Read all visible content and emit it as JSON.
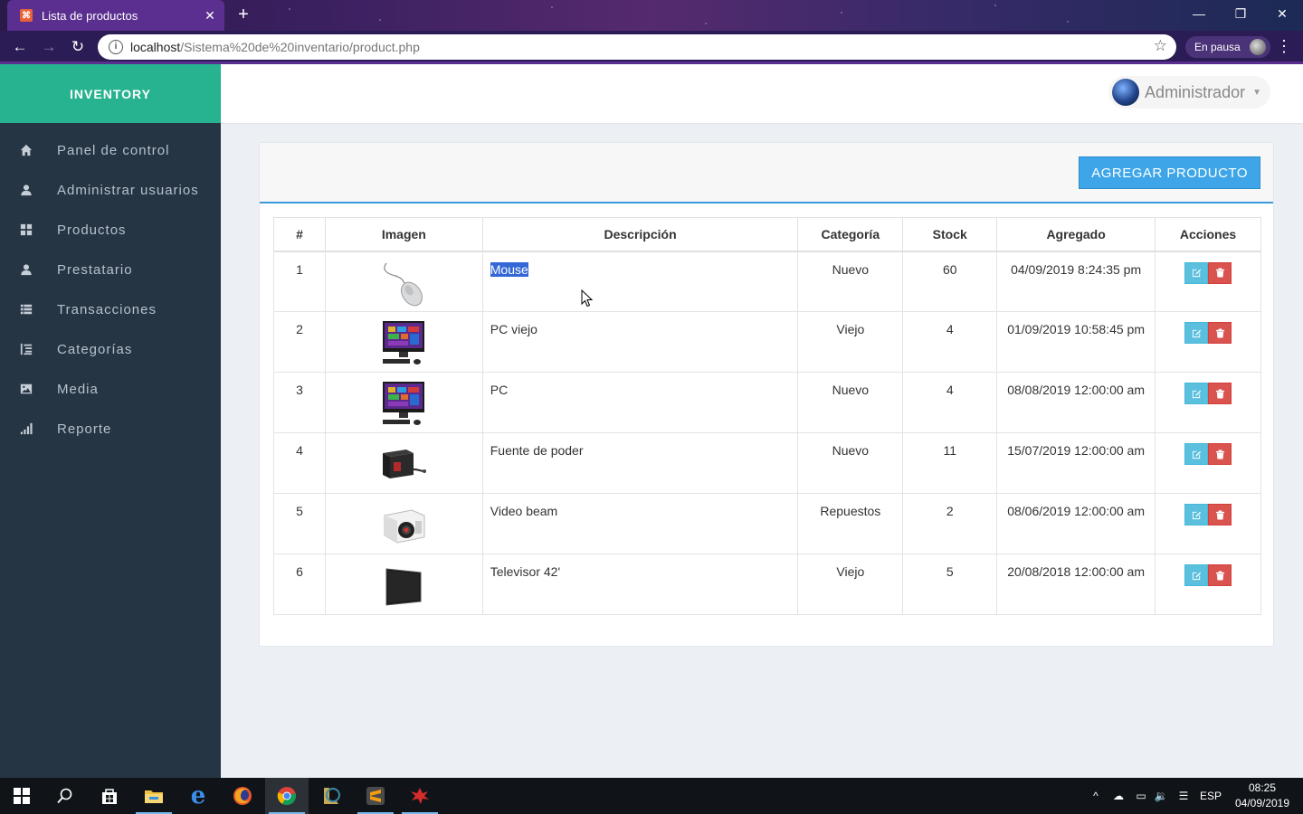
{
  "browser": {
    "tab_title": "Lista de productos",
    "url_host": "localhost",
    "url_path": "/Sistema%20de%20inventario/product.php",
    "profile_status": "En pausa"
  },
  "app": {
    "brand": "INVENTORY",
    "user_name": "Administrador",
    "sidebar": [
      {
        "label": "Panel de control",
        "icon": "home-icon"
      },
      {
        "label": "Administrar usuarios",
        "icon": "user-icon"
      },
      {
        "label": "Productos",
        "icon": "grid-icon"
      },
      {
        "label": "Prestatario",
        "icon": "user-icon"
      },
      {
        "label": "Transacciones",
        "icon": "list-icon"
      },
      {
        "label": "Categorías",
        "icon": "indent-icon"
      },
      {
        "label": "Media",
        "icon": "picture-icon"
      },
      {
        "label": "Reporte",
        "icon": "signal-icon"
      }
    ],
    "add_button": "AGREGAR PRODUCTO",
    "table": {
      "headers": [
        "#",
        "Imagen",
        "Descripción",
        "Categoría",
        "Stock",
        "Agregado",
        "Acciones"
      ],
      "rows": [
        {
          "num": "1",
          "image": "mouse-image",
          "description": "Mouse",
          "category": "Nuevo",
          "stock": "60",
          "added": "04/09/2019 8:24:35 pm"
        },
        {
          "num": "2",
          "image": "all-in-one-pc-image",
          "description": "PC viejo",
          "category": "Viejo",
          "stock": "4",
          "added": "01/09/2019 10:58:45 pm"
        },
        {
          "num": "3",
          "image": "all-in-one-pc-image",
          "description": "PC",
          "category": "Nuevo",
          "stock": "4",
          "added": "08/08/2019 12:00:00 am"
        },
        {
          "num": "4",
          "image": "power-supply-image",
          "description": "Fuente de poder",
          "category": "Nuevo",
          "stock": "11",
          "added": "15/07/2019 12:00:00 am"
        },
        {
          "num": "5",
          "image": "projector-image",
          "description": "Video beam",
          "category": "Repuestos",
          "stock": "2",
          "added": "08/06/2019 12:00:00 am"
        },
        {
          "num": "6",
          "image": "television-image",
          "description": "Televisor 42'",
          "category": "Viejo",
          "stock": "5",
          "added": "20/08/2018 12:00:00 am"
        }
      ]
    }
  },
  "taskbar": {
    "language": "ESP",
    "time": "08:25",
    "date": "04/09/2019"
  },
  "colors": {
    "sidebar_bg": "#263544",
    "brand_bg": "#27b38f",
    "accent": "#3ea6e8",
    "edit_button": "#5bc0de",
    "delete_button": "#d9534f"
  }
}
